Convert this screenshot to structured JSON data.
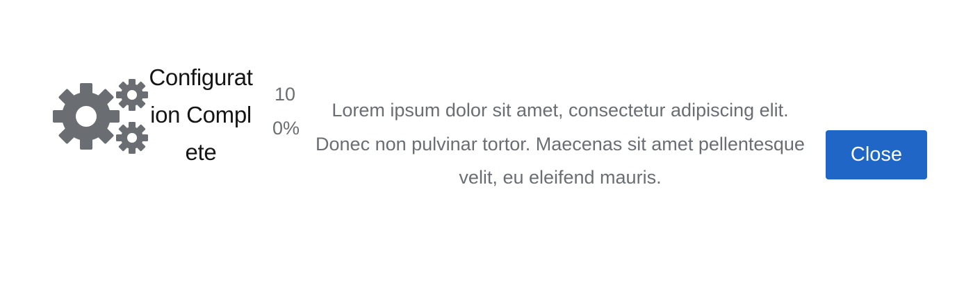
{
  "wizard": {
    "title": "Configuration Complete",
    "progress": "100%",
    "progress_value": 1.0,
    "description": "Lorem ipsum dolor sit amet, consectetur adipiscing elit. Donec non pulvinar tortor. Maecenas sit amet pellentesque velit, eu eleifend mauris.",
    "close_label": "Close",
    "icon": "cogs-icon"
  },
  "colors": {
    "accent": "#1f66c7",
    "icon": "#6a6e73",
    "title_text": "#151515",
    "body_text": "#6a6e73"
  }
}
